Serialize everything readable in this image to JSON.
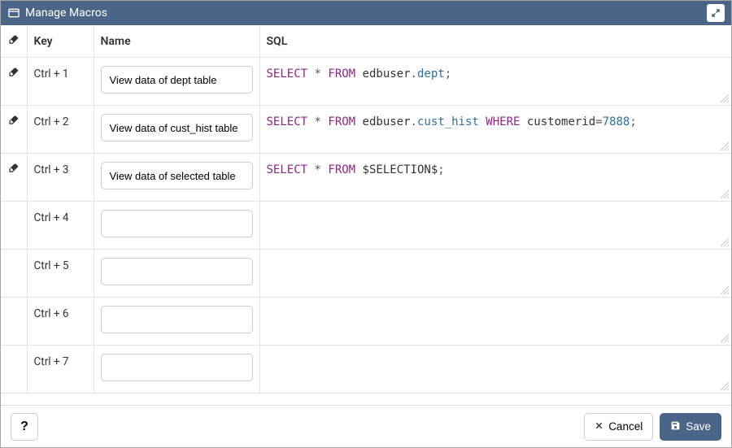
{
  "title": "Manage Macros",
  "columns": {
    "key": "Key",
    "name": "Name",
    "sql": "SQL"
  },
  "rows": [
    {
      "hasTrash": true,
      "key": "Ctrl + 1",
      "name": "View data of dept table",
      "sql": {
        "tokens": [
          [
            "kw",
            "SELECT"
          ],
          [
            "",
            ""
          ],
          [
            "punc",
            "*"
          ],
          [
            "",
            ""
          ],
          [
            "kw",
            "FROM"
          ],
          [
            "",
            ""
          ],
          [
            "",
            "edbuser"
          ],
          [
            "punc",
            "."
          ],
          [
            "ident",
            "dept"
          ],
          [
            "punc",
            ";"
          ]
        ]
      }
    },
    {
      "hasTrash": true,
      "key": "Ctrl + 2",
      "name": "View data of cust_hist table",
      "sql": {
        "tokens": [
          [
            "kw",
            "SELECT"
          ],
          [
            "",
            ""
          ],
          [
            "punc",
            "*"
          ],
          [
            "",
            ""
          ],
          [
            "kw",
            "FROM"
          ],
          [
            "",
            ""
          ],
          [
            "",
            "edbuser"
          ],
          [
            "punc",
            "."
          ],
          [
            "ident",
            "cust_hist"
          ],
          [
            "",
            ""
          ],
          [
            "kw",
            "WHERE"
          ],
          [
            "",
            ""
          ],
          [
            "",
            "customerid"
          ],
          [
            "punc",
            "="
          ],
          [
            "num",
            "7888"
          ],
          [
            "punc",
            ";"
          ]
        ]
      }
    },
    {
      "hasTrash": true,
      "key": "Ctrl + 3",
      "name": "View data of selected table",
      "sql": {
        "tokens": [
          [
            "kw",
            "SELECT"
          ],
          [
            "",
            ""
          ],
          [
            "punc",
            "*"
          ],
          [
            "",
            ""
          ],
          [
            "kw",
            "FROM"
          ],
          [
            "",
            ""
          ],
          [
            "",
            "$SELECTION$"
          ],
          [
            "punc",
            ";"
          ]
        ]
      }
    },
    {
      "hasTrash": false,
      "key": "Ctrl + 4",
      "name": "",
      "sql": {
        "tokens": []
      }
    },
    {
      "hasTrash": false,
      "key": "Ctrl + 5",
      "name": "",
      "sql": {
        "tokens": []
      }
    },
    {
      "hasTrash": false,
      "key": "Ctrl + 6",
      "name": "",
      "sql": {
        "tokens": []
      }
    },
    {
      "hasTrash": false,
      "key": "Ctrl + 7",
      "name": "",
      "sql": {
        "tokens": []
      }
    }
  ],
  "footer": {
    "help": "?",
    "cancel": "Cancel",
    "save": "Save"
  }
}
